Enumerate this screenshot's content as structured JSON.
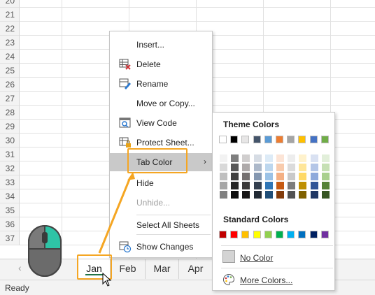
{
  "grid": {
    "row_numbers": [
      "20",
      "21",
      "22",
      "23",
      "24",
      "25",
      "26",
      "27",
      "28",
      "29",
      "30",
      "31",
      "32",
      "33",
      "34",
      "35",
      "36",
      "37"
    ]
  },
  "tabs": {
    "nav_left": "‹",
    "items": [
      {
        "label": "Jan",
        "active": true
      },
      {
        "label": "Feb",
        "active": false
      },
      {
        "label": "Mar",
        "active": false
      },
      {
        "label": "Apr",
        "active": false
      }
    ]
  },
  "status": {
    "text": "Ready"
  },
  "context_menu": {
    "insert": "Insert...",
    "delete": "Delete",
    "rename": "Rename",
    "move_copy": "Move or Copy...",
    "view_code": "View Code",
    "protect": "Protect Sheet...",
    "tab_color": "Tab Color",
    "hide": "Hide",
    "unhide": "Unhide...",
    "select_all": "Select All Sheets",
    "show_changes": "Show Changes",
    "submenu_arrow": "›"
  },
  "color_menu": {
    "theme_title": "Theme Colors",
    "standard_title": "Standard Colors",
    "no_color": "No Color",
    "more_colors": "More Colors...",
    "theme_base": [
      "#ffffff",
      "#000000",
      "#e7e6e6",
      "#44546a",
      "#5b9bd5",
      "#ed7d31",
      "#a5a5a5",
      "#ffc000",
      "#4472c4",
      "#70ad47"
    ],
    "theme_shades": [
      [
        "#f2f2f2",
        "#d9d9d9",
        "#bfbfbf",
        "#a6a6a6",
        "#808080"
      ],
      [
        "#7f7f7f",
        "#595959",
        "#404040",
        "#262626",
        "#0d0d0d"
      ],
      [
        "#d0cece",
        "#aeaaaa",
        "#757171",
        "#3a3838",
        "#171616"
      ],
      [
        "#d6dce4",
        "#adb9ca",
        "#8497b0",
        "#333f4f",
        "#222a35"
      ],
      [
        "#ddebf7",
        "#bdd7ee",
        "#9bc2e6",
        "#2f75b5",
        "#1f4e78"
      ],
      [
        "#fce4d6",
        "#f8cbad",
        "#f4b084",
        "#c65911",
        "#833c0b"
      ],
      [
        "#ededed",
        "#dbdbdb",
        "#c9c9c9",
        "#7b7b7b",
        "#525252"
      ],
      [
        "#fff2cc",
        "#ffe699",
        "#ffd966",
        "#bf8f00",
        "#7f6000"
      ],
      [
        "#d9e1f2",
        "#b4c6e7",
        "#8ea9db",
        "#305496",
        "#203764"
      ],
      [
        "#e2efda",
        "#c6e0b4",
        "#a9d08e",
        "#548235",
        "#375623"
      ]
    ],
    "standard": [
      "#c00000",
      "#ff0000",
      "#ffc000",
      "#ffff00",
      "#92d050",
      "#00b050",
      "#00b0f0",
      "#0070c0",
      "#002060",
      "#7030a0"
    ]
  },
  "accent": {
    "highlight": "#f5a623",
    "excel_green": "#217346"
  }
}
